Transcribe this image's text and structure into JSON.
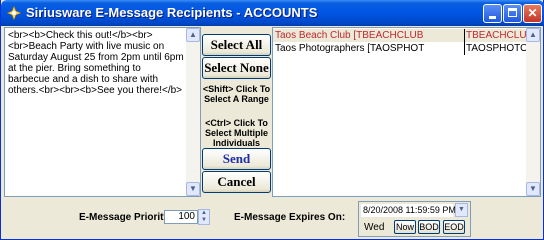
{
  "window": {
    "title": "Siriusware E-Message Recipients - ACCOUNTS",
    "title_color": "#ffffff",
    "titlebar_color": "#0054e3"
  },
  "message": {
    "text": "<br><b>Check this out!</b><br><br>Beach Party with live music on Saturday August 25 from 2pm until 6pm at the pier. Bring something to barbecue and a dish to share with others.<br><br><b>See you there!</b>"
  },
  "buttons": {
    "select_all": "Select All",
    "select_none": "Select None",
    "shift_hint": "<Shift> Click To Select A Range",
    "ctrl_hint": "<Ctrl> Click To Select Multiple Individuals",
    "send": "Send",
    "cancel": "Cancel"
  },
  "recipients": [
    {
      "name": "Taos Beach Club [TBEACHCLUB",
      "code": "TBEACHCLUB",
      "selected": true
    },
    {
      "name": "Taos Photographers [TAOSPHOT",
      "code": "TAOSPHOTO",
      "selected": false
    }
  ],
  "priority": {
    "label": "E-Message Priority:",
    "value": "100"
  },
  "expires": {
    "label": "E-Message Expires On:",
    "datetime": "8/20/2008 11:59:59 PM",
    "day": "Wed",
    "now": "Now",
    "bod": "BOD",
    "eod": "EOD"
  },
  "colors": {
    "selected_text": "#c0272d",
    "send_text": "#1e2ea7",
    "accent": "#0054e3"
  },
  "icons": [
    "app-icon",
    "minimize-icon",
    "maximize-icon",
    "close-icon",
    "scroll-up-icon",
    "scroll-down-icon",
    "spin-up-icon",
    "spin-down-icon",
    "dropdown-arrow-icon"
  ]
}
